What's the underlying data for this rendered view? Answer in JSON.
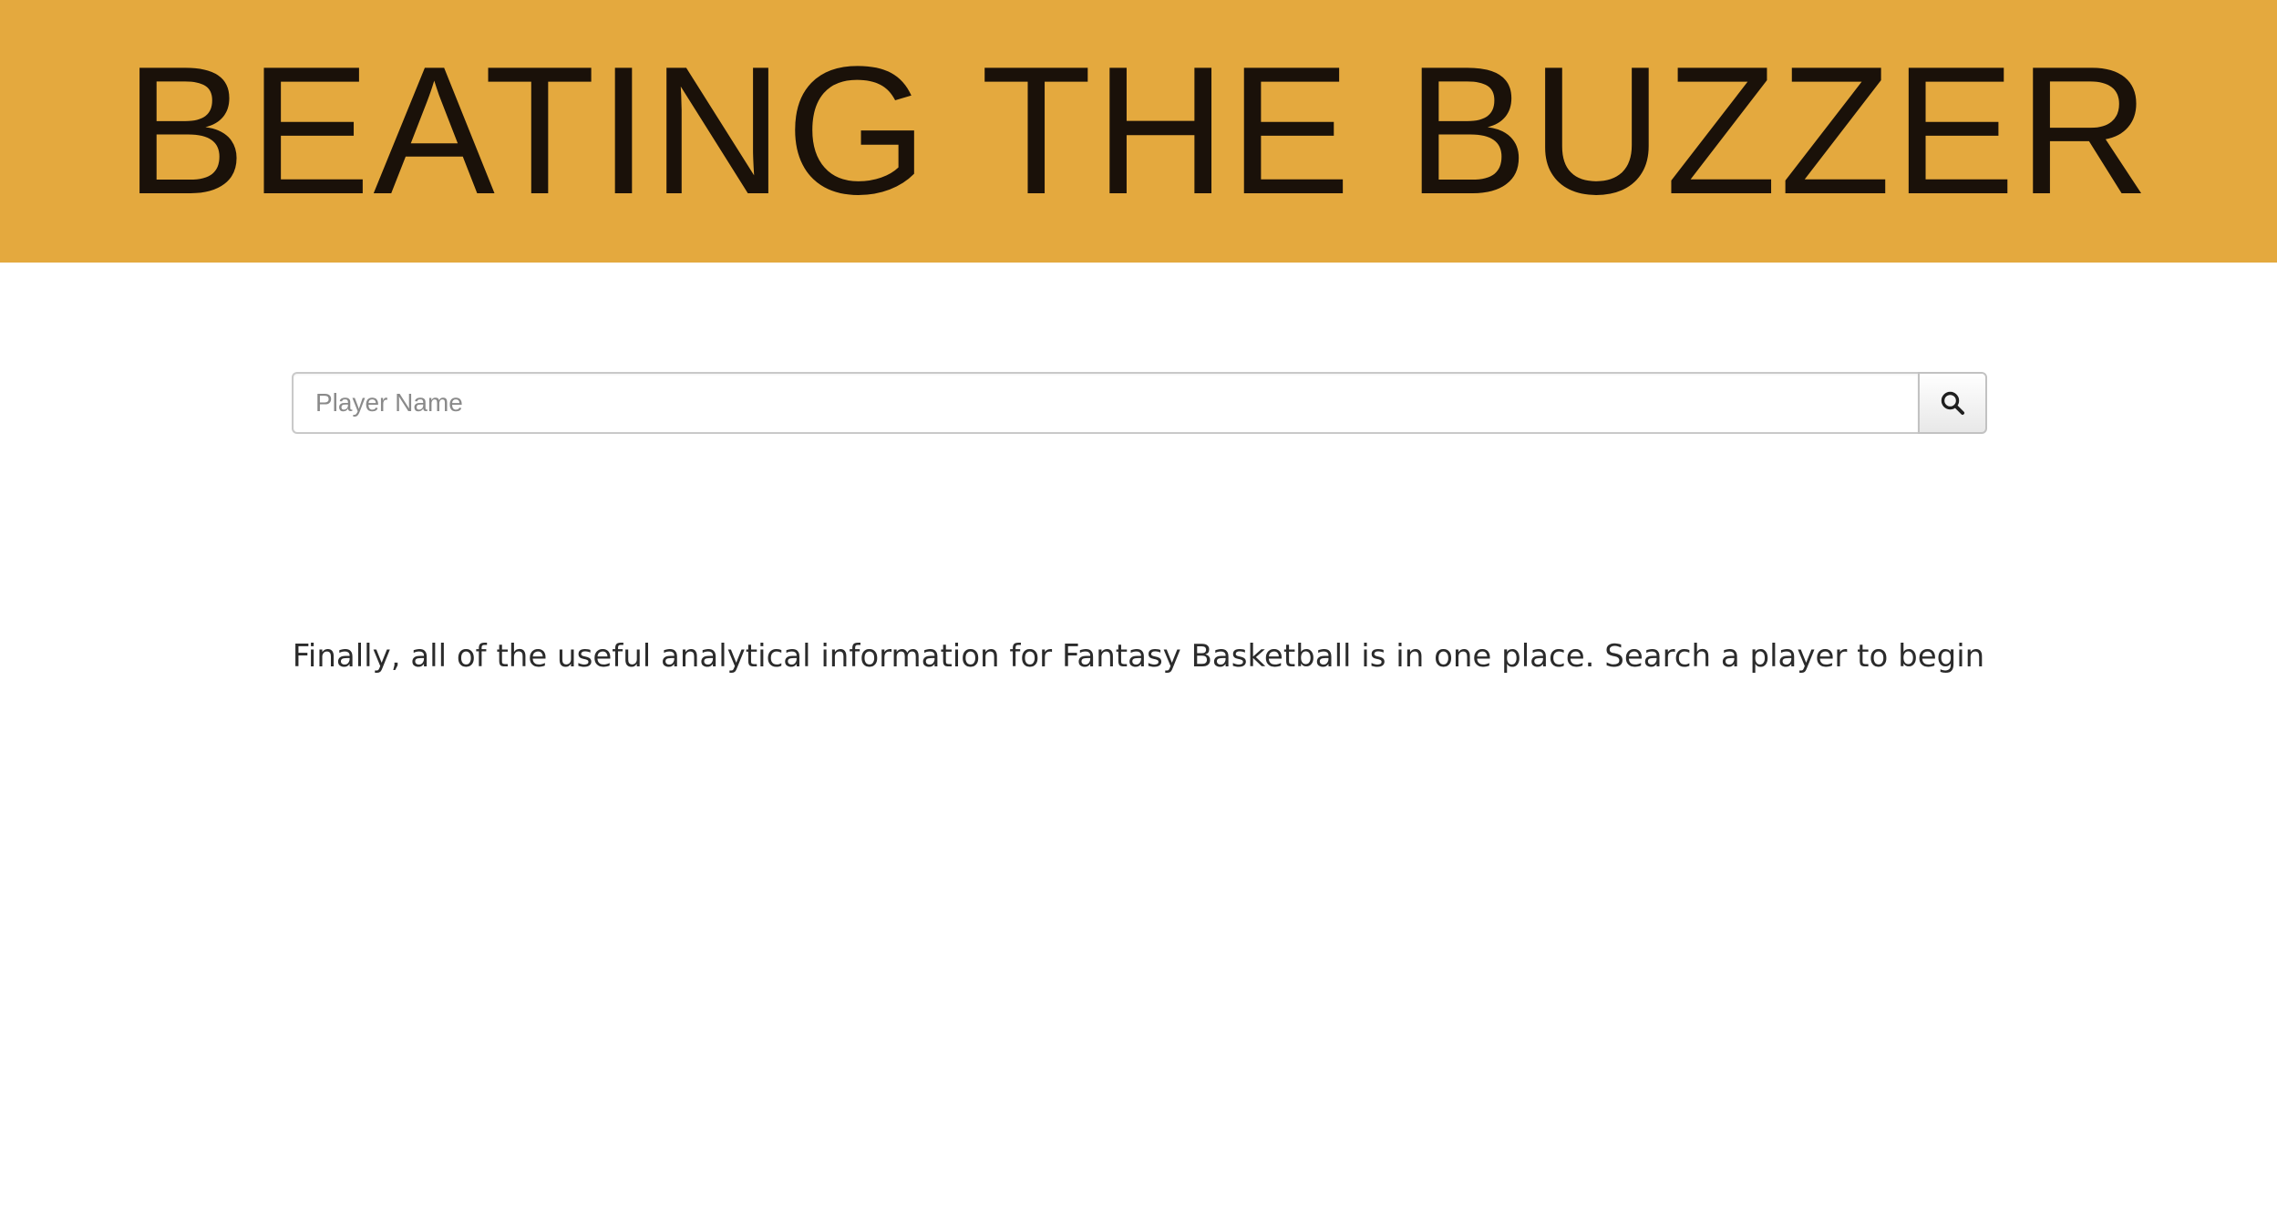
{
  "header": {
    "title": "BEATING THE BUZZER",
    "background_color": "#e4a93e",
    "title_color": "#1a1109"
  },
  "search": {
    "placeholder": "Player Name",
    "value": "",
    "button_icon": "search-icon"
  },
  "main": {
    "tagline": "Finally, all of the useful analytical information for Fantasy Basketball is in one place. Search a player to begin"
  }
}
